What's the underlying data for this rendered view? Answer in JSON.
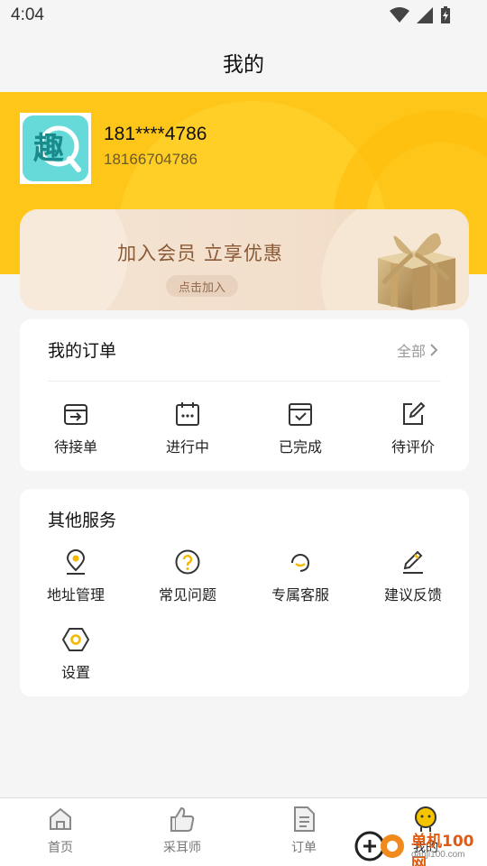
{
  "status": {
    "time": "4:04"
  },
  "header": {
    "title": "我的"
  },
  "user": {
    "phone_masked": "181****4786",
    "user_id": "18166704786",
    "avatar_glyph": "趣"
  },
  "vip": {
    "title": "加入会员 立享优惠",
    "button": "点击加入"
  },
  "orders": {
    "title": "我的订单",
    "all_label": "全部",
    "items": [
      {
        "label": "待接单",
        "icon": "pending-order-icon"
      },
      {
        "label": "进行中",
        "icon": "calendar-icon"
      },
      {
        "label": "已完成",
        "icon": "completed-icon"
      },
      {
        "label": "待评价",
        "icon": "edit-icon"
      }
    ]
  },
  "services": {
    "title": "其他服务",
    "items": [
      {
        "label": "地址管理",
        "icon": "location-icon"
      },
      {
        "label": "常见问题",
        "icon": "question-icon"
      },
      {
        "label": "专属客服",
        "icon": "customer-service-icon"
      },
      {
        "label": "建议反馈",
        "icon": "feedback-pen-icon"
      },
      {
        "label": "设置",
        "icon": "settings-hexagon-icon"
      }
    ]
  },
  "tabs": [
    {
      "label": "首页",
      "icon": "home-icon"
    },
    {
      "label": "采耳师",
      "icon": "thumbs-up-icon"
    },
    {
      "label": "订单",
      "icon": "document-icon"
    },
    {
      "label": "我的",
      "icon": "profile-face-icon",
      "active": true
    }
  ],
  "watermark": {
    "brand": "单机100网",
    "url": "danji100.com"
  },
  "colors": {
    "accent": "#ffc61a",
    "icon_accent": "#f5b800",
    "vip_text": "#8a5a36"
  }
}
